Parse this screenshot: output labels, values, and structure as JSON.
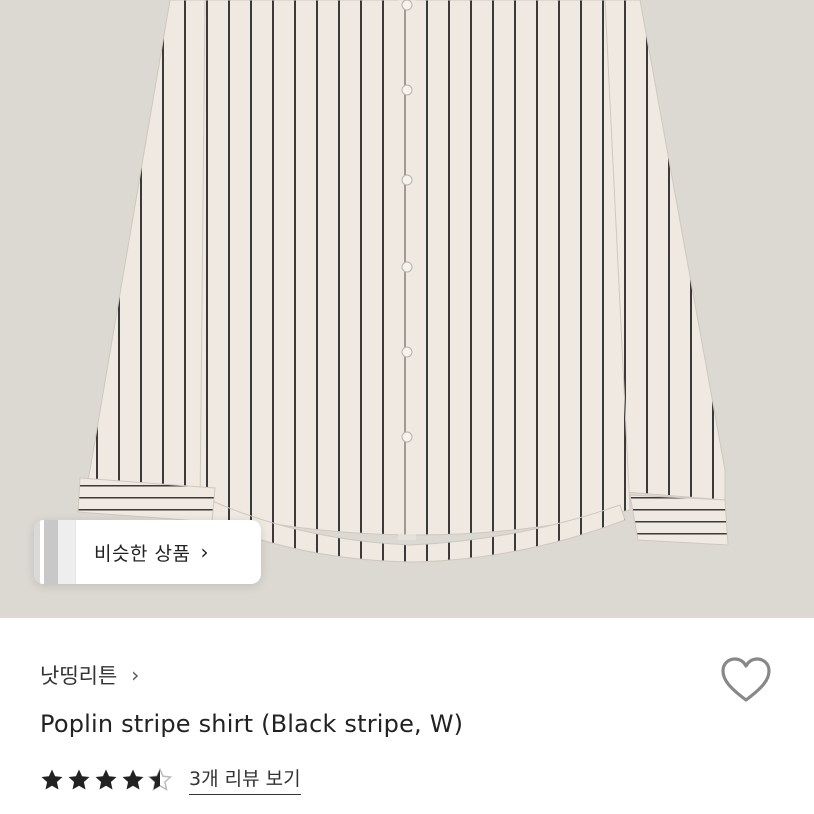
{
  "product_image": {
    "subject": "striped-shirt",
    "background_color": "#dcd8d2",
    "fabric_color": "#efe9e1",
    "stripe_color": "#3a3a3a"
  },
  "similar_products": {
    "label": "비슷한 상품",
    "chevron": "›"
  },
  "shop": {
    "name": "낫띵리튼",
    "chevron": "›"
  },
  "wishlist": {
    "icon": "heart-outline-icon",
    "color": "#888888"
  },
  "product": {
    "title": "Poplin stripe shirt (Black stripe, W)"
  },
  "rating": {
    "value": 4.5,
    "max": 5,
    "star_color": "#222222",
    "review_link_label": "3개 리뷰 보기"
  }
}
